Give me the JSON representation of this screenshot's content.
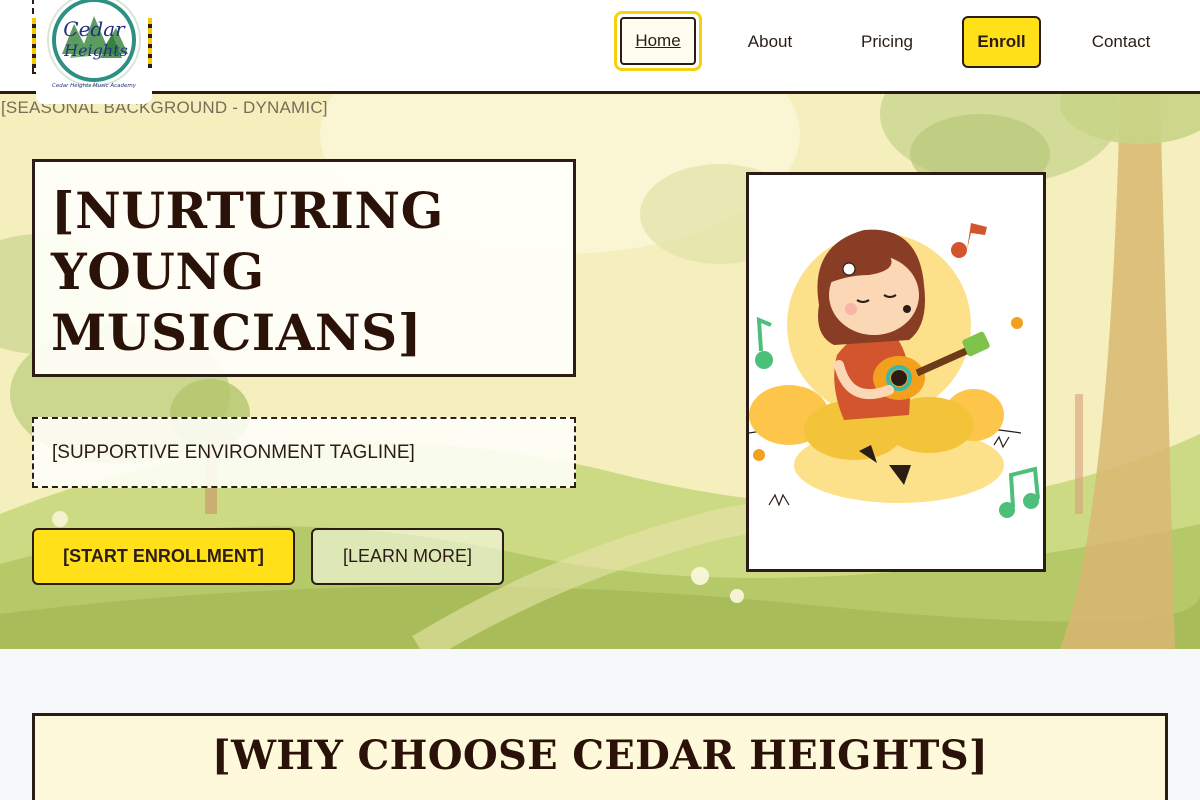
{
  "brand": {
    "name": "Cedar Heights",
    "logo_text_line1": "Cedar",
    "logo_text_line2": "Heights",
    "logo_subtext": "Cedar Heights Music Academy"
  },
  "nav": {
    "items": [
      {
        "label": "Home",
        "active": true
      },
      {
        "label": "About"
      },
      {
        "label": "Pricing"
      },
      {
        "label": "Enroll",
        "highlight": true
      },
      {
        "label": "Contact"
      }
    ]
  },
  "hero": {
    "background_label": "[SEASONAL BACKGROUND - DYNAMIC]",
    "title": "[NURTURING YOUNG MUSICIANS]",
    "tagline": "[SUPPORTIVE ENVIRONMENT TAGLINE]",
    "primary_button": "[START ENROLLMENT]",
    "secondary_button": "[LEARN MORE]"
  },
  "why": {
    "title": "[WHY CHOOSE CEDAR HEIGHTS]"
  },
  "colors": {
    "accent_yellow": "#ffe019",
    "dark": "#2b1d16",
    "hero_bg": "#f4ecb8",
    "why_box_bg": "#fff9dc"
  },
  "icons": {
    "logo": "cedar-heights-logo",
    "illustration": "girl-playing-ukulele-illustration"
  }
}
